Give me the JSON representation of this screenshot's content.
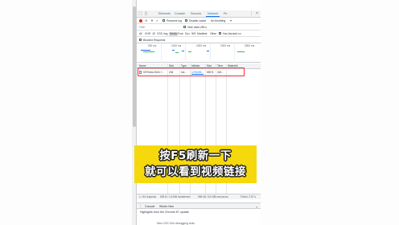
{
  "devtools": {
    "tabs": [
      "Elements",
      "Console",
      "Sources",
      "Network",
      "Pe"
    ],
    "active_tab": "Network"
  },
  "toolbar": {
    "preserve_log": "Preserve log",
    "disable_cache": "Disable cache",
    "throttling": "No throttling"
  },
  "filter": {
    "placeholder": "Filter",
    "hide_data_urls": "Hide data URLs"
  },
  "type_filters": [
    "All",
    "XHR",
    "JS",
    "CSS",
    "Img",
    "Media",
    "Font",
    "Doc",
    "WS",
    "Manifest",
    "Other",
    "Has blocked co"
  ],
  "active_type_filter": "Media",
  "blocked_requests": "Blocked Requests",
  "overview_ticks": [
    "500 ms",
    "1000 ms",
    "1500 ms",
    "2000 ms",
    "2500 ms"
  ],
  "table": {
    "columns": [
      "Name",
      "Stat",
      "Type",
      "Initiator",
      "Size",
      "Time",
      "Waterfall"
    ],
    "rows": [
      {
        "name": "f297feba-30b0-7...",
        "status": "206",
        "type": "me...",
        "initiator": "1276253...",
        "size": "659 B",
        "time": "400..."
      }
    ]
  },
  "caption": {
    "line1": "按F5刷新一下",
    "line2": "就可以看到视频链接"
  },
  "statusbar": {
    "requests": "1 / 64 requests",
    "transferred": "659 B / 1.8 MB transferred",
    "resources": "658 kB / 8.5 MB resources",
    "finish": "Finish: 2.57 s"
  },
  "drawer": {
    "tabs": [
      "Console",
      "What's New"
    ],
    "close": "×",
    "highlights": "Highlights from the Chrome 87 update",
    "new_item": "New CSS Grid debugging tools"
  },
  "icons": [
    "inspect-icon",
    "device-toolbar-icon",
    "record-icon",
    "clear-icon",
    "filter-icon",
    "search-icon",
    "more-icon",
    "close-icon",
    "file-icon"
  ]
}
